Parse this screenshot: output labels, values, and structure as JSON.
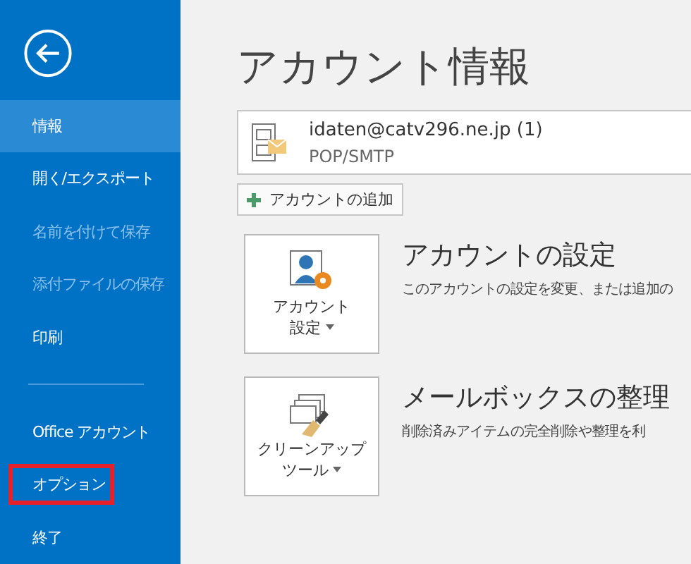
{
  "sidebar": {
    "items": [
      {
        "label": "情報",
        "selected": true,
        "disabled": false,
        "highlighted": false
      },
      {
        "label": "開く/エクスポート",
        "selected": false,
        "disabled": false,
        "highlighted": false
      },
      {
        "label": "名前を付けて保存",
        "selected": false,
        "disabled": true,
        "highlighted": false
      },
      {
        "label": "添付ファイルの保存",
        "selected": false,
        "disabled": true,
        "highlighted": false
      },
      {
        "label": "印刷",
        "selected": false,
        "disabled": false,
        "highlighted": false
      },
      {
        "kind": "divider"
      },
      {
        "label": "Office アカウント",
        "selected": false,
        "disabled": false,
        "highlighted": false
      },
      {
        "label": "オプション",
        "selected": false,
        "disabled": false,
        "highlighted": true
      },
      {
        "label": "終了",
        "selected": false,
        "disabled": false,
        "highlighted": false
      }
    ]
  },
  "main": {
    "title": "アカウント情報",
    "account": {
      "address": "idaten@catv296.ne.jp (1)",
      "type": "POP/SMTP"
    },
    "add_account_button": "アカウントの追加",
    "sections": [
      {
        "kind": "settings",
        "button_lines": [
          "アカウント",
          "設定"
        ],
        "title": "アカウントの設定",
        "description": "このアカウントの設定を変更、または追加の"
      },
      {
        "kind": "cleanup",
        "button_lines": [
          "クリーンアップ",
          "ツール"
        ],
        "title": "メールボックスの整理",
        "description": "削除済みアイテムの完全削除や整理を利"
      }
    ]
  }
}
